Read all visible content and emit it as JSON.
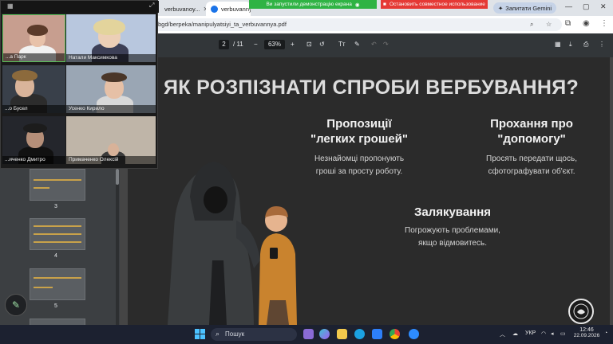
{
  "browser": {
    "tabs": [
      {
        "label": "verbuvanoy..."
      },
      {
        "label": "verbuvannya_perehovani_proektu..."
      }
    ],
    "sharing_banner": "Ви запустили демонстрацію екрана",
    "stop_sharing": "Остановить совместное использование",
    "gemini_button": "Запитати Gemini",
    "url": "bgd/berpeka/manipulyatsiyi_ta_verbuvannya.pdf"
  },
  "pdf": {
    "page_current": "2",
    "page_total": "/ 11",
    "zoom": "63%",
    "thumbnails": [
      {
        "number": "3"
      },
      {
        "number": "4"
      },
      {
        "number": "5"
      }
    ]
  },
  "slide": {
    "title": "ЯК РОЗПІЗНАТИ СПРОБИ ВЕРБУВАННЯ?",
    "blocks": [
      {
        "heading_line1": "Пропозиції",
        "heading_line2": "\"легких грошей\"",
        "text_line1": "Незнайомці пропонують",
        "text_line2": "гроші за просту роботу."
      },
      {
        "heading_line1": "Прохання про",
        "heading_line2": "\"допомогу\"",
        "text_line1": "Просять передати щось,",
        "text_line2": "сфотографувати об'єкт."
      },
      {
        "heading_line1": "Залякування",
        "heading_line2": "",
        "text_line1": "Погрожують проблемами,",
        "text_line2": "якщо відмовитесь."
      }
    ]
  },
  "video_call": {
    "participants": [
      {
        "name": "...а Парк"
      },
      {
        "name": "Натали Максимкова"
      },
      {
        "name": "...о Бусел"
      },
      {
        "name": "Усенко Кирило"
      },
      {
        "name": "...иченко Дмитро"
      },
      {
        "name": "Примаченко Олексій"
      }
    ]
  },
  "taskbar": {
    "search_placeholder": "Пошук",
    "language": "УКР",
    "time": "12:46",
    "date": "22.09.2026"
  }
}
